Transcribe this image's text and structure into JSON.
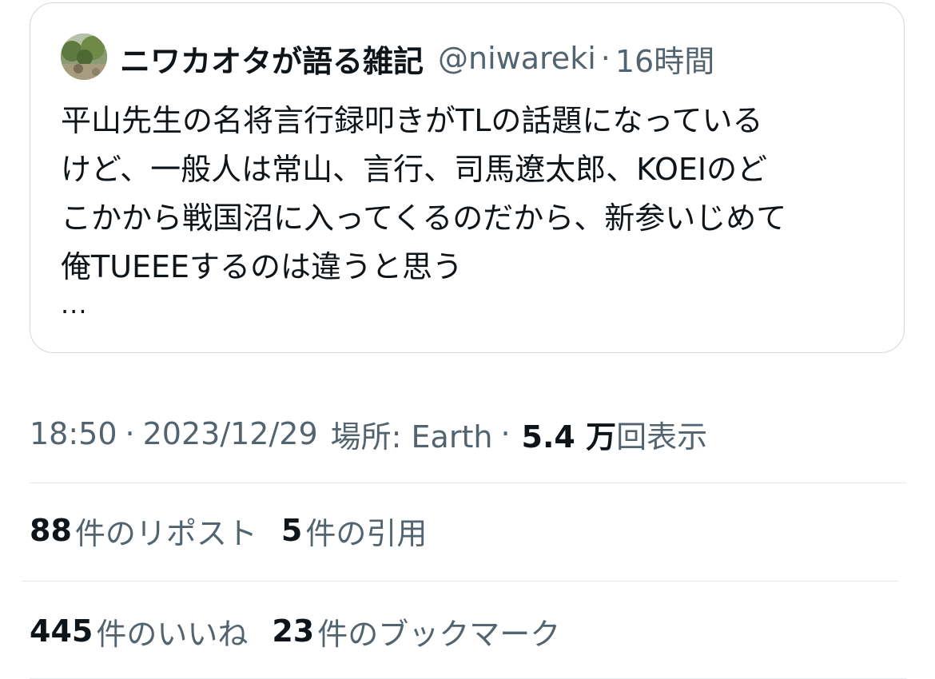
{
  "quoted_tweet": {
    "avatar_icon": "garden-avatar-icon",
    "display_name": "ニワカオタが語る雑記",
    "handle": "@niwareki",
    "separator": "·",
    "relative_time": "16時間",
    "body": "平山先生の名将言行録叩きがTLの話題になっている\nけど、一般人は常山、言行、司馬遼太郎、KOEIのど\nこかから戦国沼に入ってくるのだから、新参いじめて\n俺TUEEEするのは違うと思う",
    "ellipsis": "..."
  },
  "meta": {
    "time": "18:50",
    "separator": "·",
    "date": "2023/12/29",
    "location_label": "場所: Earth",
    "views_count": "5.4 万",
    "views_label": "回表示"
  },
  "stats_row1": [
    {
      "count": "88",
      "label": "件のリポスト"
    },
    {
      "count": "5",
      "label": "件の引用"
    }
  ],
  "stats_row2": [
    {
      "count": "445",
      "label": "件のいいね"
    },
    {
      "count": "23",
      "label": "件のブックマーク"
    }
  ],
  "colors": {
    "text_primary": "#0f1419",
    "text_secondary": "#536471",
    "border": "#cfd9de",
    "divider": "#e3e8eb"
  }
}
